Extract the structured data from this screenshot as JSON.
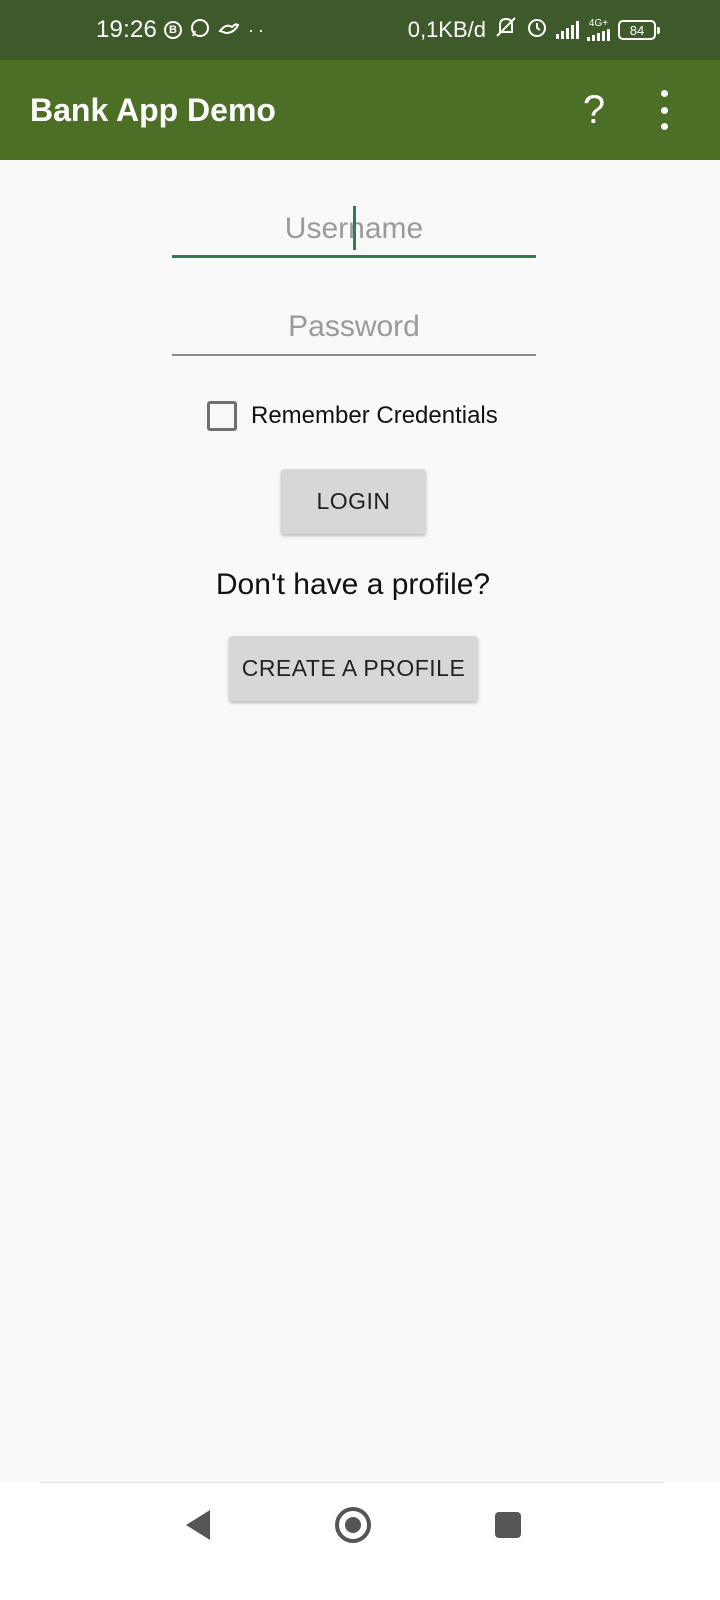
{
  "status_bar": {
    "time": "19:26",
    "b_badge": "B",
    "data_speed": "0,1KB/d",
    "network_type": "4G+",
    "battery": "84",
    "icons": [
      "b-circle-icon",
      "whatsapp-icon",
      "bird-icon",
      "more-notifications-icon",
      "vibrate-off-icon",
      "alarm-icon",
      "signal-icon",
      "signal-4g-icon",
      "battery-icon"
    ]
  },
  "app_bar": {
    "title": "Bank App Demo",
    "help_label": "?",
    "color": "#4b6f24"
  },
  "login_form": {
    "username_placeholder": "Username",
    "username_value": "",
    "password_placeholder": "Password",
    "password_value": "",
    "remember_label": "Remember Credentials",
    "remember_checked": false,
    "login_label": "LOGIN",
    "no_profile_text": "Don't have a profile?",
    "create_profile_label": "CREATE A PROFILE",
    "accent_color": "#2e7d4f"
  },
  "nav_bar": {
    "icons": [
      "back-icon",
      "home-icon",
      "recents-icon"
    ]
  }
}
